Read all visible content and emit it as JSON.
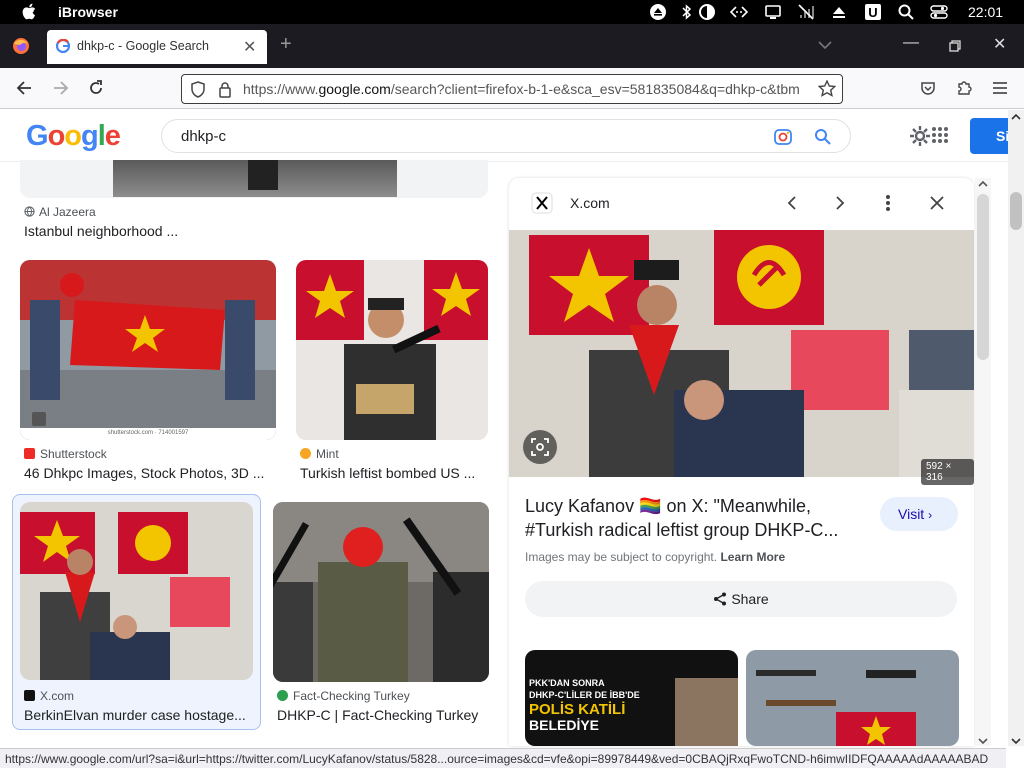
{
  "os": {
    "app_name": "iBrowser",
    "clock": "22:01"
  },
  "tab": {
    "title": "dhkp-c - Google Search"
  },
  "address": {
    "url_prefix": "https://www.",
    "url_host": "google.com",
    "url_rest": "/search?client=firefox-b-1-e&sca_esv=581835084&q=dhkp-c&tbm"
  },
  "google": {
    "query": "dhkp-c",
    "signin_label": "Si"
  },
  "results": [
    {
      "source": "Al Jazeera",
      "caption": "Istanbul neighborhood ..."
    },
    {
      "source": "Shutterstock",
      "caption": "46 Dhkpc Images, Stock Photos, 3D ...",
      "watermark": "shutterstock.com · 714001597"
    },
    {
      "source": "Mint",
      "caption": "Turkish leftist bombed US ..."
    },
    {
      "source": "X.com",
      "caption": "BerkinElvan murder case hostage..."
    },
    {
      "source": "Fact-Checking Turkey",
      "caption": "DHKP-C | Fact-Checking Turkey"
    }
  ],
  "panel": {
    "source": "X.com",
    "image_size": "592 × 316",
    "caption_line1": "Lucy Kafanov 🏳️‍🌈 on X: \"Meanwhile,",
    "caption_line2": "#Turkish radical leftist group DHKP-C...",
    "visit_label": "Visit",
    "copyright_text": "Images may be subject to copyright.",
    "learn_more": "Learn More",
    "share_label": "Share",
    "related_headline_1": "PKK'DAN SONRA",
    "related_headline_2": "DHKP-C'LİLER DE İBB'DE",
    "related_headline_3": "POLİS KATİLİ",
    "related_headline_4": "BELEDİYE"
  },
  "status_url": "https://www.google.com/url?sa=i&url=https://twitter.com/LucyKafanov/status/5828...ource=images&cd=vfe&opi=89978449&ved=0CBAQjRxqFwoTCND-h6imwIIDFQAAAAAdAAAAABAD",
  "colors": {
    "google_blue": "#4285f4",
    "google_red": "#ea4335",
    "google_yellow": "#fbbc05",
    "google_green": "#34a853",
    "flag_red": "#c8102e",
    "star_yellow": "#f2c500"
  }
}
